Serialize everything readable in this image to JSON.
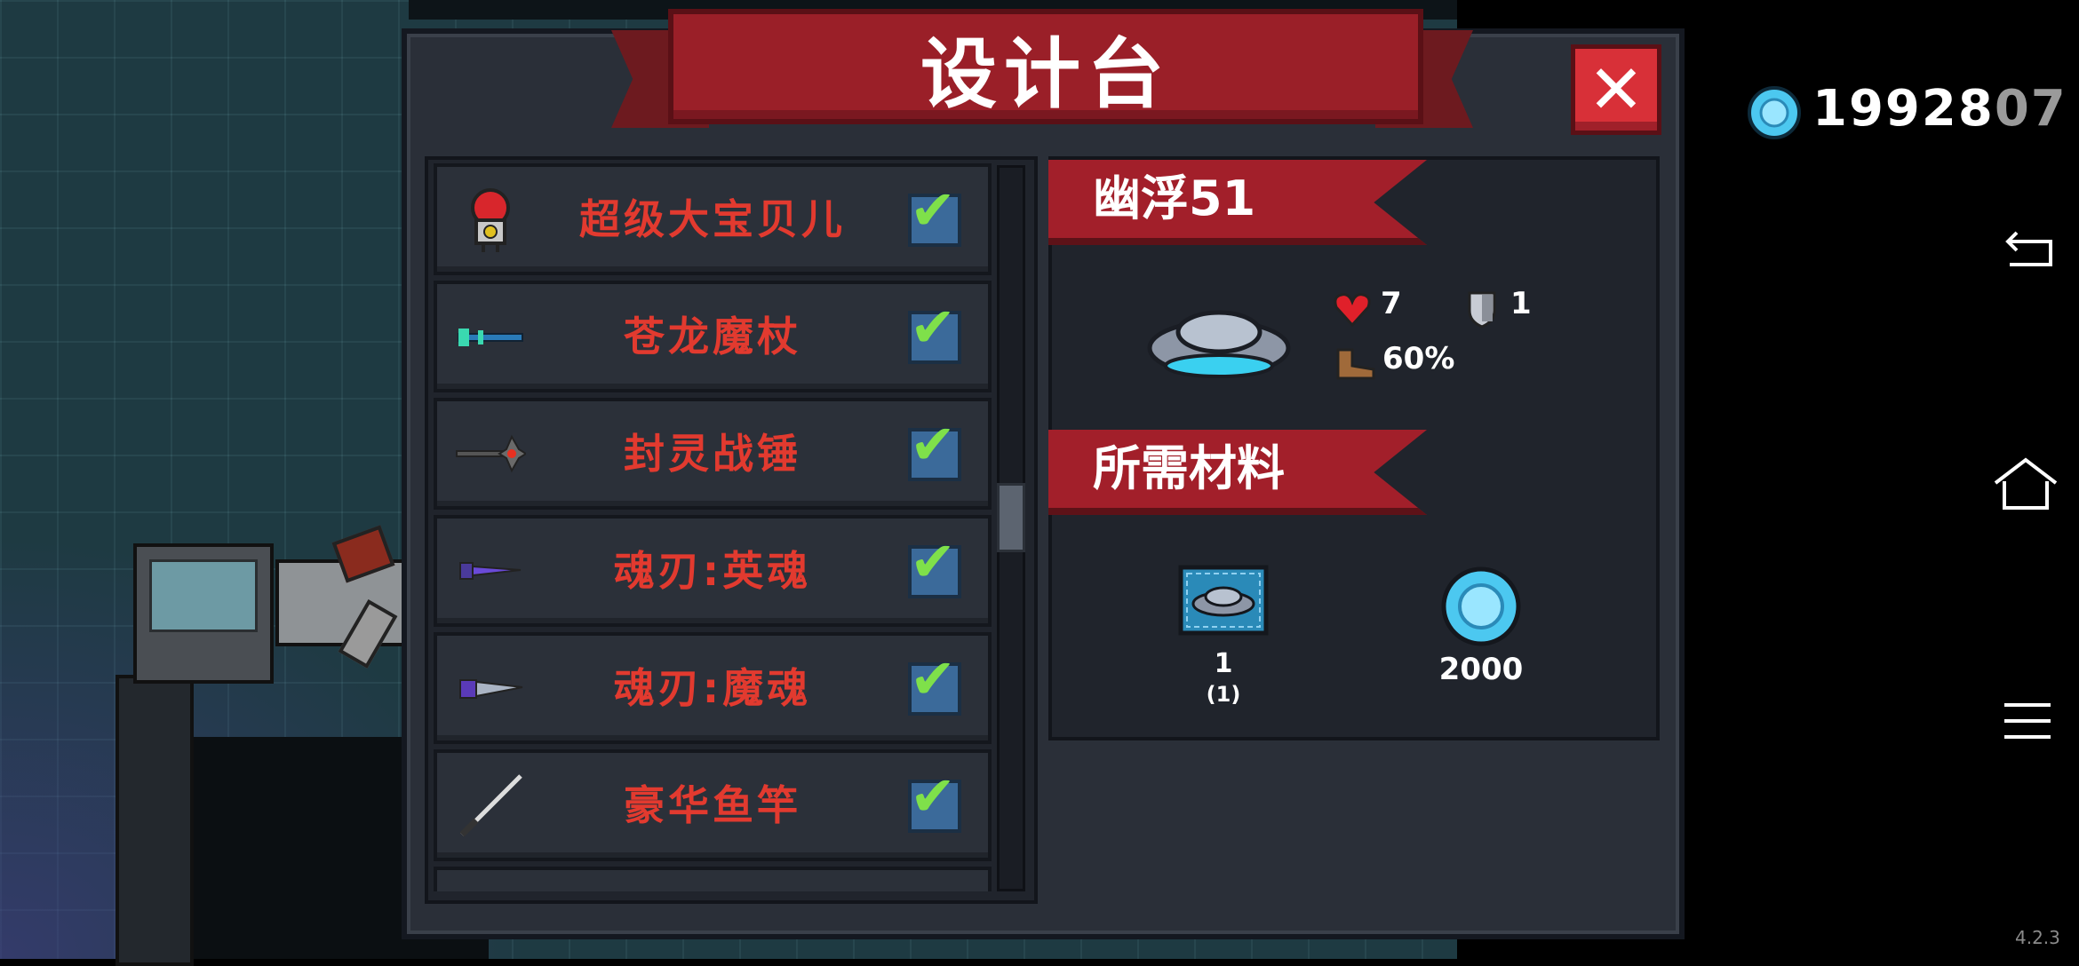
{
  "header": {
    "title": "设计台",
    "close_icon": "close-icon"
  },
  "currency": {
    "icon": "gem-icon",
    "value_main": "19928",
    "value_dim": "07"
  },
  "list": {
    "items": [
      {
        "name": "超级大宝贝儿",
        "icon": "bomb-icon",
        "checked": true
      },
      {
        "name": "苍龙魔杖",
        "icon": "staff-icon",
        "checked": true
      },
      {
        "name": "封灵战锤",
        "icon": "hammer-icon",
        "checked": true
      },
      {
        "name": "魂刃:英魂",
        "icon": "sword-icon",
        "checked": true
      },
      {
        "name": "魂刃:魔魂",
        "icon": "sword-icon",
        "checked": true
      },
      {
        "name": "豪华鱼竿",
        "icon": "fishing-rod-icon",
        "checked": true
      }
    ]
  },
  "detail": {
    "item_name": "幽浮51",
    "stats": {
      "health": "7",
      "armor": "1",
      "speed": "60%"
    },
    "materials_title": "所需材料",
    "materials": [
      {
        "icon": "ufo-blueprint-icon",
        "count": "1",
        "owned": "(1)"
      },
      {
        "icon": "gem-icon",
        "count": "2000"
      }
    ]
  },
  "system": {
    "version": "4.2.3"
  },
  "colors": {
    "banner_red": "#9a1f28",
    "item_name_red": "#e23a2f",
    "check_green": "#7fe04a",
    "gem_blue": "#4cc8f0",
    "panel_bg": "#2a2f38"
  }
}
